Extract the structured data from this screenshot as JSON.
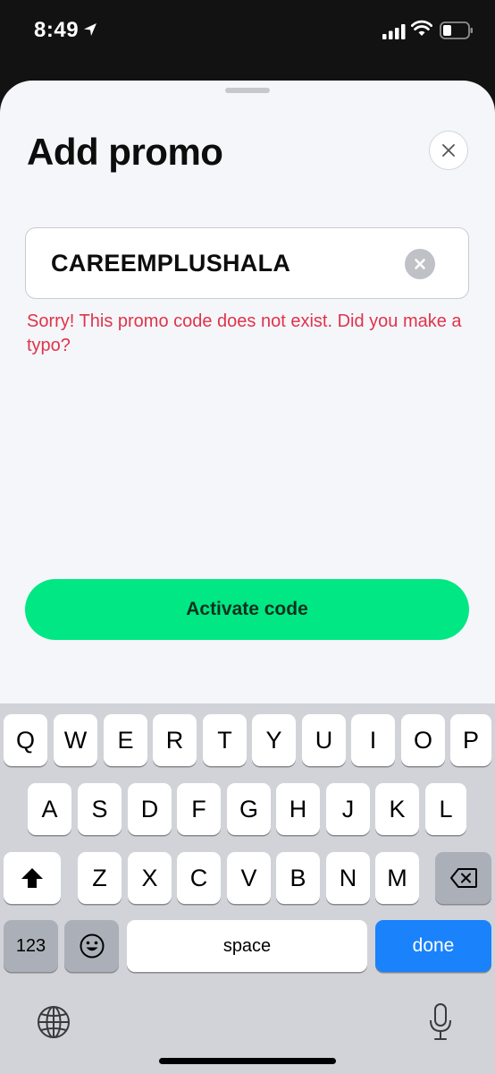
{
  "status_bar": {
    "time": "8:49",
    "icons": [
      "location-arrow-icon",
      "cellular-signal-icon",
      "wifi-icon",
      "battery-icon"
    ]
  },
  "sheet": {
    "title": "Add promo",
    "close_icon": "close-icon",
    "promo_field": {
      "value": "CAREEMPLUSHALA",
      "clear_icon": "clear-icon"
    },
    "error_message": "Sorry! This promo code does not exist. Did you make a typo?",
    "activate_label": "Activate code"
  },
  "keyboard": {
    "row1": [
      "Q",
      "W",
      "E",
      "R",
      "T",
      "Y",
      "U",
      "I",
      "O",
      "P"
    ],
    "row2": [
      "A",
      "S",
      "D",
      "F",
      "G",
      "H",
      "J",
      "K",
      "L"
    ],
    "row3": [
      "Z",
      "X",
      "C",
      "V",
      "B",
      "N",
      "M"
    ],
    "numbers_label": "123",
    "space_label": "space",
    "done_label": "done",
    "icons": [
      "shift-icon",
      "backspace-icon",
      "emoji-icon",
      "globe-icon",
      "microphone-icon"
    ]
  },
  "colors": {
    "accent": "#00e784",
    "error": "#e0334a",
    "done_key": "#1a82fb"
  }
}
